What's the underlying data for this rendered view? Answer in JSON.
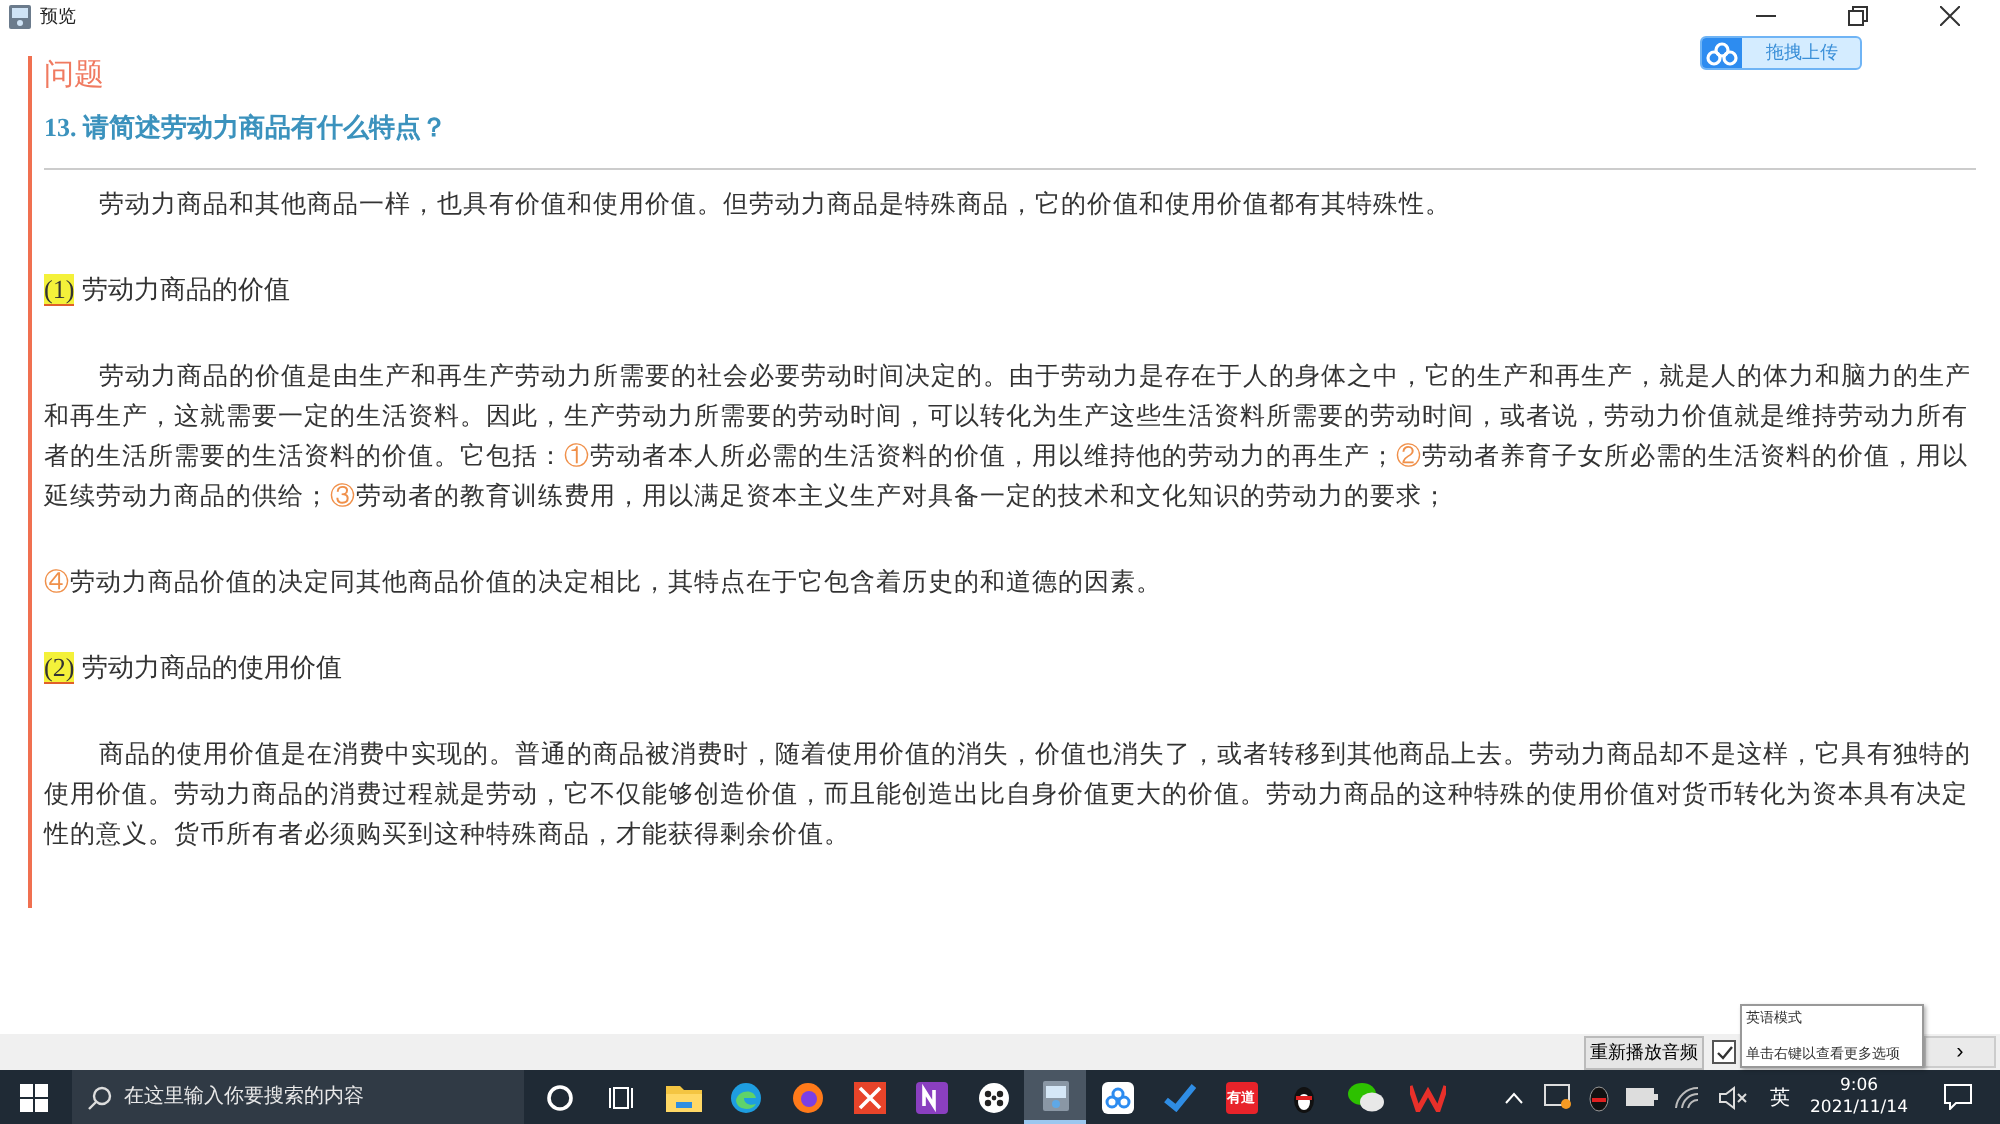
{
  "window": {
    "title": "预览"
  },
  "upload_button": {
    "label": "拖拽上传"
  },
  "question": {
    "section_label": "问题",
    "title": "13. 请简述劳动力商品有什么特点？"
  },
  "blocks": [
    {
      "kind": "paragraph",
      "indented": true,
      "segments": [
        {
          "kind": "plain",
          "text": "劳动力商品和其他商品一样，也具有价值和使用价值。但劳动力商品是特殊商品，它的价值和使用价值都有其特殊性。"
        }
      ]
    },
    {
      "kind": "heading",
      "number": "(1)",
      "text": "劳动力商品的价值"
    },
    {
      "kind": "paragraph",
      "indented": true,
      "segments": [
        {
          "kind": "plain",
          "text": "劳动力商品的价值是由生产和再生产劳动力所需要的社会必要劳动时间决定的。由于劳动力是存在于人的身体之中，它的生产和再生产，就是人的体力和脑力的生产和再生产，这就需要一定的生活资料。因此，生产劳动力所需要的劳动时间，可以转化为生产这些生活资料所需要的劳动时间，或者说，劳动力价值就是维持劳动力所有者的生活所需要的生活资料的价值。它包括："
        },
        {
          "kind": "marker",
          "text": "①"
        },
        {
          "kind": "plain",
          "text": "劳动者本人所必需的生活资料的价值，用以维持他的劳动力的再生产；"
        },
        {
          "kind": "marker",
          "text": "②"
        },
        {
          "kind": "plain",
          "text": "劳动者养育子女所必需的生活资料的价值，用以延续劳动力商品的供给；"
        },
        {
          "kind": "marker",
          "text": "③"
        },
        {
          "kind": "plain",
          "text": "劳动者的教育训练费用，用以满足资本主义生产对具备一定的技术和文化知识的劳动力的要求；"
        }
      ]
    },
    {
      "kind": "paragraph",
      "indented": false,
      "segments": [
        {
          "kind": "marker",
          "text": "④"
        },
        {
          "kind": "plain",
          "text": "劳动力商品价值的决定同其他商品价值的决定相比，其特点在于它包含着历史的和道德的因素。"
        }
      ]
    },
    {
      "kind": "heading",
      "number": "(2)",
      "text": "劳动力商品的使用价值"
    },
    {
      "kind": "paragraph",
      "indented": true,
      "segments": [
        {
          "kind": "plain",
          "text": "商品的使用价值是在消费中实现的。普通的商品被消费时，随着使用价值的消失，价值也消失了，或者转移到其他商品上去。劳动力商品却不是这样，它具有独特的使用价值。劳动力商品的消费过程就是劳动，它不仅能够创造价值，而且能创造出比自身价值更大的价值。劳动力商品的这种特殊的使用价值对货币转化为资本具有决定性的意义。货币所有者必须购买到这种特殊商品，才能获得剩余价值。"
        }
      ]
    }
  ],
  "bottom_bar": {
    "replay_button": "重新播放音频",
    "checked": true,
    "next_button": "›"
  },
  "tooltip": {
    "title": "英语模式",
    "hint": "单击右键以查看更多选项"
  },
  "taskbar": {
    "search_placeholder": "在这里输入你要搜索的内容",
    "apps": [
      {
        "kind": "circle",
        "selected": false
      },
      {
        "kind": "taskview",
        "selected": false
      },
      {
        "kind": "folder",
        "selected": false
      },
      {
        "kind": "edge",
        "selected": false
      },
      {
        "kind": "firefox",
        "selected": false
      },
      {
        "kind": "xapp",
        "selected": false
      },
      {
        "kind": "onenote",
        "selected": false
      },
      {
        "kind": "dots",
        "selected": false
      },
      {
        "kind": "preview",
        "selected": true
      },
      {
        "kind": "cloud",
        "selected": false
      },
      {
        "kind": "check",
        "selected": false
      },
      {
        "kind": "label",
        "label": "有道",
        "selected": false
      },
      {
        "kind": "penguin",
        "selected": false
      },
      {
        "kind": "chat",
        "selected": false
      },
      {
        "kind": "wps",
        "selected": false
      }
    ],
    "ime": "英",
    "time": "9:06",
    "date": "2021/11/14"
  }
}
